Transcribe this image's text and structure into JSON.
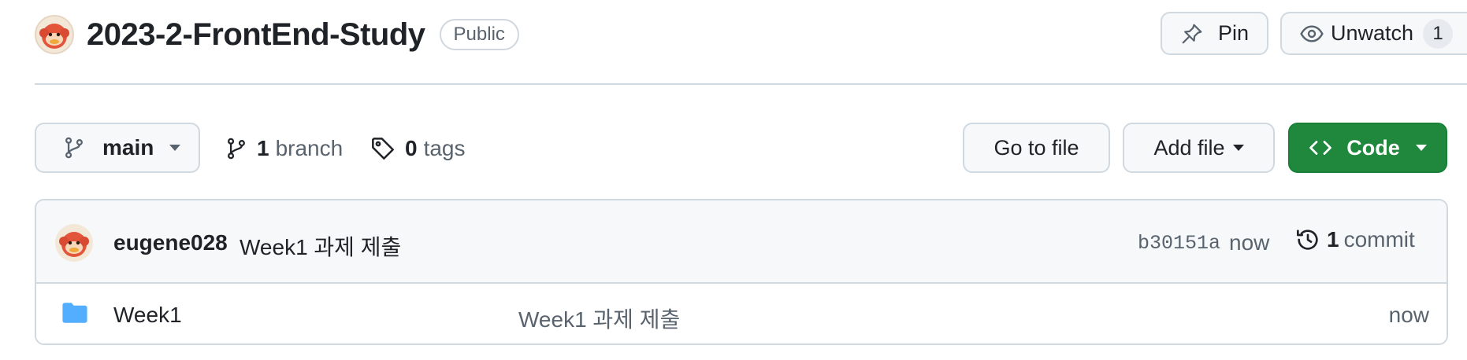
{
  "repo": {
    "name": "2023-2-FrontEnd-Study",
    "visibility": "Public",
    "pin_label": "Pin",
    "watch_label": "Unwatch",
    "watch_count": "1"
  },
  "toolbar": {
    "branch": "main",
    "branches_count": "1",
    "branches_label": "branch",
    "tags_count": "0",
    "tags_label": "tags",
    "goto_file_label": "Go to file",
    "add_file_label": "Add file",
    "code_label": "Code"
  },
  "latest_commit": {
    "author": "eugene028",
    "message": "Week1 과제 제출",
    "sha": "b30151a",
    "time": "now",
    "count": "1",
    "count_label": "commit"
  },
  "files": [
    {
      "name": "Week1",
      "type": "folder",
      "icon": "folder-icon",
      "commit_message": "Week1 과제 제출",
      "time": "now"
    }
  ],
  "colors": {
    "accent_green": "#1f883d",
    "folder_blue": "#54aeff",
    "border": "#d1d9e0",
    "muted_text": "#59636e"
  }
}
